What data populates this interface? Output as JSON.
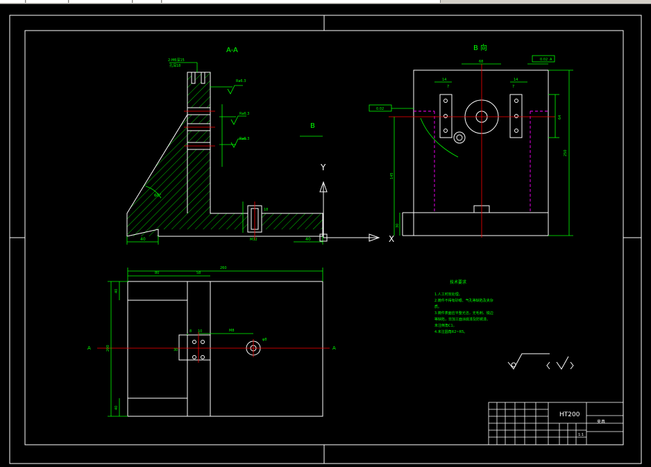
{
  "colors": {
    "background": "#000000",
    "border": "#ffffff",
    "dimension": "#00ff00",
    "hatch": "#00ff00",
    "centerline": "#ff0000",
    "hidden": "#ff00ff",
    "axis": "#ffffff"
  },
  "views": {
    "section_title": "A-A",
    "side_title": "B 向",
    "view_arrow_label": "B",
    "ucs_y": "Y",
    "ucs_x": "X",
    "section_mark_left": "A",
    "section_mark_right": "A"
  },
  "section_dims": {
    "left_width": "40",
    "right_width": "40",
    "angle": "60°",
    "slot_width": "M12",
    "roughness": "Ra6.3",
    "depth": "18",
    "note_top": "2-M6深15",
    "note_sub": "孔深18"
  },
  "side_dims": {
    "top_width": "68",
    "left_w": "14",
    "right_w": "14",
    "height": "250",
    "inner_height": "145",
    "bottom": "30",
    "right_mid": "64",
    "small_left": "7",
    "small_right": "7",
    "tol_top": "0.02",
    "tol_side": "0.02",
    "tol_ref": "A"
  },
  "plan_dims": {
    "total": "260",
    "left": "80",
    "mid": "58",
    "height": "200",
    "top_step": "40",
    "bottom_step": "40",
    "hole_a": "8",
    "hole_b": "10",
    "hole_offset": "30",
    "circle_note": "φ8",
    "slot_note": "M8"
  },
  "notes": {
    "title": "技术要求",
    "lines": [
      "1.人工时效处理。",
      "2.铸件不得有砂眼、气孔等缺陷及夹杂",
      "质。",
      "3.铸件表面应平整光洁，无毛刺、锐边",
      "等缺陷，非加工面涂底漆及防锈漆。",
      "未注倒角C1。",
      "4.未注圆角R2~R5。"
    ]
  },
  "title_block": {
    "material": "HT200",
    "part_name": "夹具",
    "scale": "1:1"
  }
}
